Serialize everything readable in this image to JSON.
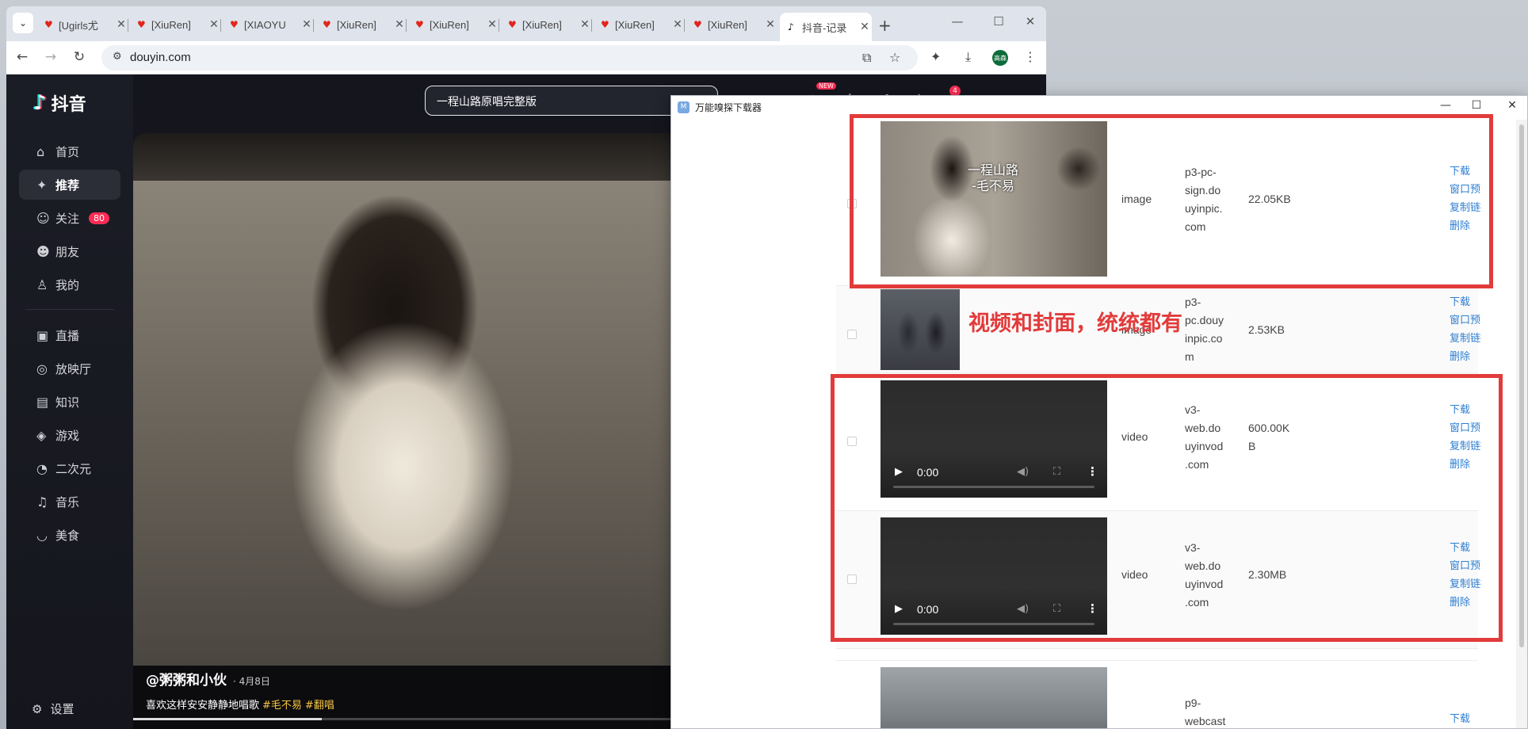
{
  "browser": {
    "tabs": [
      {
        "title": "[Ugirls尤"
      },
      {
        "title": "[XiuRen]"
      },
      {
        "title": "[XIAOYU"
      },
      {
        "title": "[XiuRen]"
      },
      {
        "title": "[XiuRen]"
      },
      {
        "title": "[XiuRen]"
      },
      {
        "title": "[XiuRen]"
      },
      {
        "title": "[XiuRen]"
      },
      {
        "title": "抖音-记录"
      }
    ],
    "url": "douyin.com",
    "profile_label": "高森"
  },
  "douyin": {
    "logo": "抖音",
    "search_text": "一程山路原唱完整版",
    "new_badge": "NEW",
    "msg_badge": "4",
    "nav": [
      {
        "label": "首页",
        "icon": "home-icon"
      },
      {
        "label": "推荐",
        "icon": "sparkle-icon"
      },
      {
        "label": "关注",
        "icon": "follow-icon",
        "badge": "80"
      },
      {
        "label": "朋友",
        "icon": "friends-icon"
      },
      {
        "label": "我的",
        "icon": "user-icon"
      },
      {
        "label": "直播",
        "icon": "tv-icon"
      },
      {
        "label": "放映厅",
        "icon": "cinema-icon"
      },
      {
        "label": "知识",
        "icon": "book-icon"
      },
      {
        "label": "游戏",
        "icon": "gamepad-icon"
      },
      {
        "label": "二次元",
        "icon": "anime-icon"
      },
      {
        "label": "音乐",
        "icon": "music-icon"
      },
      {
        "label": "美食",
        "icon": "food-icon"
      }
    ],
    "settings_label": "设置",
    "video": {
      "author": "@粥粥和小伙",
      "date": "· 4月8日",
      "desc": "喜欢这样安安静静地唱歌",
      "tags": [
        "#毛不易",
        "#翻唱"
      ],
      "progress_fraction": 0.34
    }
  },
  "downloader": {
    "title": "万能嗅探下载器",
    "actions": [
      "下载",
      "窗口预览",
      "复制链接",
      "删除"
    ],
    "rows": [
      {
        "type": "image",
        "host": [
          "p3-pc-",
          "sign.do",
          "uyinpic.",
          "com"
        ],
        "size": [
          "22.05KB"
        ],
        "overlay": [
          "一程山路",
          "-毛不易"
        ]
      },
      {
        "type": "image",
        "host": [
          "p3-",
          "pc.douy",
          "inpic.co",
          "m"
        ],
        "size": [
          "2.53KB"
        ]
      },
      {
        "type": "video",
        "host": [
          "v3-",
          "web.do",
          "uyinvod",
          ".com"
        ],
        "size": [
          "600.00K",
          "B"
        ],
        "time": "0:00"
      },
      {
        "type": "video",
        "host": [
          "v3-",
          "web.do",
          "uyinvod",
          ".com"
        ],
        "size": [
          "2.30MB"
        ],
        "time": "0:00"
      },
      {
        "type": "image",
        "host": [
          "p9-",
          "webcast"
        ],
        "size": []
      }
    ]
  },
  "annotation": {
    "text": "视频和封面，统统都有",
    "color": "#e23b3b"
  }
}
